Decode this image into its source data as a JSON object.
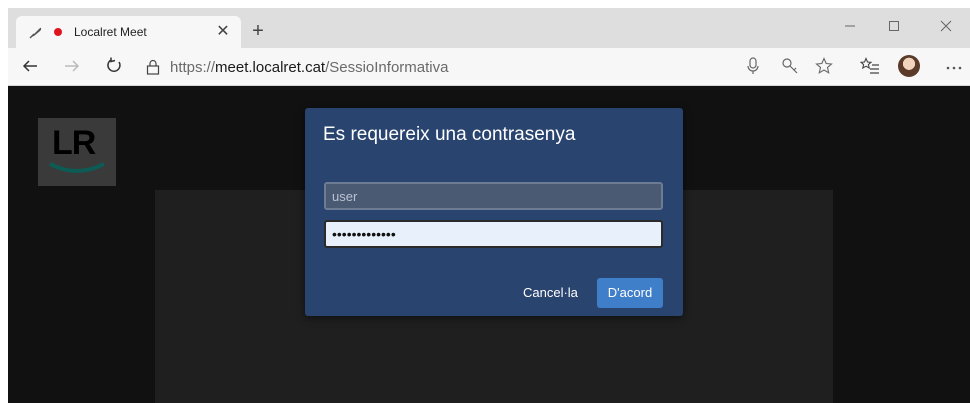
{
  "browser": {
    "tab_title": "Localret Meet",
    "tab_close": "✕",
    "new_tab": "+",
    "url_prefix": "https://",
    "url_host": "meet.localret.cat",
    "url_path": "/SessioInformativa"
  },
  "page": {
    "logo_text": "LR"
  },
  "dialog": {
    "title": "Es requereix una contrasenya",
    "user_placeholder": "user",
    "password_value": "•••••••••••••",
    "cancel_label": "Cancel·la",
    "ok_label": "D'acord"
  },
  "colors": {
    "dialog_bg": "#2a4470",
    "ok_button": "#3f7ec9",
    "page_bg": "#111111"
  }
}
